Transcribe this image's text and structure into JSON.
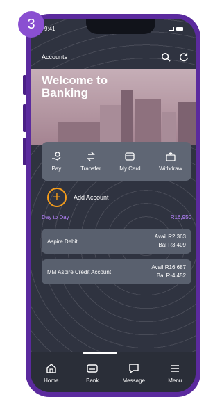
{
  "step_badge": "3",
  "status_bar": {
    "time": "9:41"
  },
  "header": {
    "title": "Accounts",
    "icons": [
      "search-icon",
      "refresh-icon"
    ]
  },
  "hero": {
    "title": "Welcome to Banking"
  },
  "quick_actions": [
    {
      "label": "Pay",
      "icon": "pay-icon"
    },
    {
      "label": "Transfer",
      "icon": "transfer-icon"
    },
    {
      "label": "My Card",
      "icon": "card-icon"
    },
    {
      "label": "Withdraw",
      "icon": "withdraw-icon"
    }
  ],
  "add_account": {
    "label": "Add Account"
  },
  "section": {
    "title": "Day to Day",
    "total": "R16,950"
  },
  "accounts": [
    {
      "name": "Aspire Debit",
      "available": "Avail R2,363",
      "balance": "Bal R3,409"
    },
    {
      "name": "MM Aspire Credit Account",
      "available": "Avail R16,687",
      "balance": "Bal R-4,452"
    }
  ],
  "bottom_nav": [
    {
      "label": "Home",
      "icon": "home-icon"
    },
    {
      "label": "Bank",
      "icon": "bank-card-icon",
      "active": true
    },
    {
      "label": "Message",
      "icon": "message-icon"
    },
    {
      "label": "Menu",
      "icon": "menu-icon"
    }
  ],
  "colors": {
    "frame": "#5b2a9e",
    "accent": "#8a4fd1",
    "plus": "#f59d1b",
    "section": "#b784ff",
    "screen": "#2f3340"
  }
}
